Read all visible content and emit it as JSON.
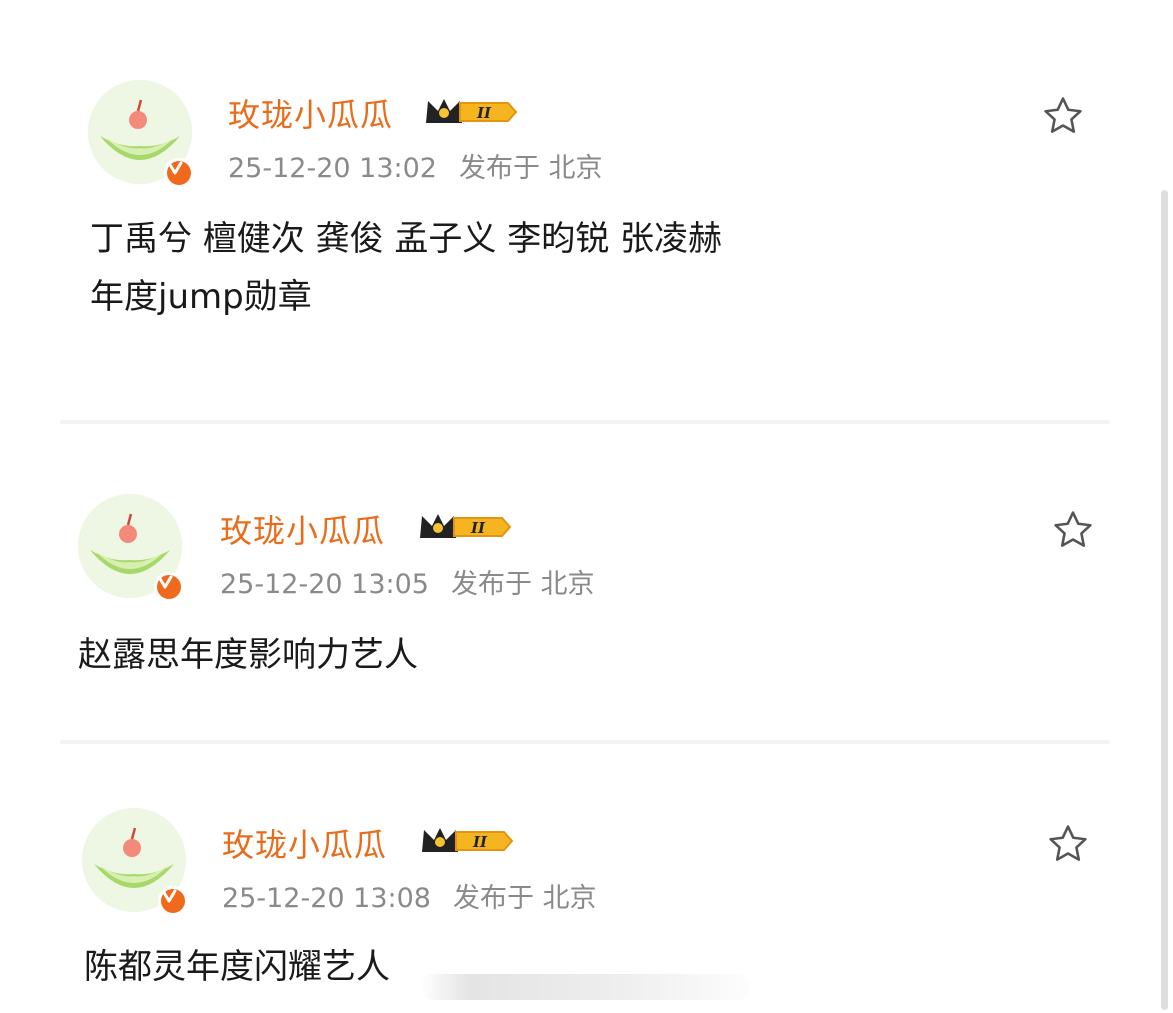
{
  "posts": [
    {
      "username": "玫珑小瓜瓜",
      "level_badge": "II",
      "time": "25-12-20 13:02",
      "location": "发布于 北京",
      "content_lines": [
        "丁禹兮 檀健次 龚俊  孟子义 李昀锐 张凌赫",
        "年度jump勋章"
      ],
      "avatar_icon": "melon-avatar-icon",
      "verified_icon": "verified-v-icon",
      "favorite_icon": "star-outline-icon"
    },
    {
      "username": "玫珑小瓜瓜",
      "level_badge": "II",
      "time": "25-12-20 13:05",
      "location": "发布于 北京",
      "content_lines": [
        "赵露思年度影响力艺人"
      ],
      "avatar_icon": "melon-avatar-icon",
      "verified_icon": "verified-v-icon",
      "favorite_icon": "star-outline-icon"
    },
    {
      "username": "玫珑小瓜瓜",
      "level_badge": "II",
      "time": "25-12-20 13:08",
      "location": "发布于 北京",
      "content_lines": [
        "陈都灵年度闪耀艺人"
      ],
      "avatar_icon": "melon-avatar-icon",
      "verified_icon": "verified-v-icon",
      "favorite_icon": "star-outline-icon"
    }
  ],
  "colors": {
    "username": "#e96c1a",
    "meta": "#8a8a8a",
    "content": "#1a1a1a",
    "verified_badge": "#ef6a1c",
    "crown": "#222222",
    "level_badge_bg": "#f5b520"
  }
}
